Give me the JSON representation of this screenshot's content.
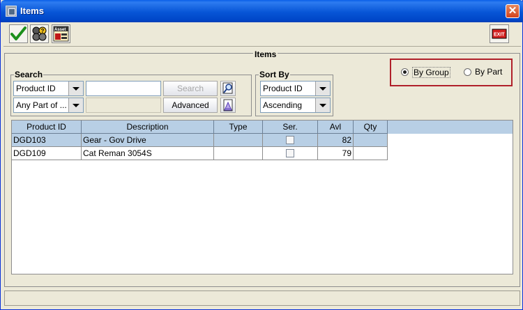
{
  "window": {
    "title": "Items",
    "close_glyph": "✕"
  },
  "toolbar": {
    "accept_icon": "checkmark-icon",
    "lookup_icon": "group-help-icon",
    "asset_icon": "asset-icon",
    "asset_text": "Asset",
    "exit_text": "EXIT"
  },
  "panel": {
    "title": "Items"
  },
  "search": {
    "group_title": "Search",
    "field_combo": "Product ID",
    "match_combo": "Any Part of ...",
    "query_value": "",
    "search_button": "Search",
    "advanced_button": "Advanced"
  },
  "sort": {
    "group_title": "Sort By",
    "field_combo": "Product ID",
    "order_combo": "Ascending"
  },
  "view_mode": {
    "by_group_label": "By Group",
    "by_part_label": "By Part",
    "selected": "By Group"
  },
  "table": {
    "columns": [
      "Product ID",
      "Description",
      "Type",
      "Ser.",
      "Avl",
      "Qty"
    ],
    "rows": [
      {
        "product_id": "DGD103",
        "description": "Gear - Gov Drive",
        "type": "",
        "serialized": false,
        "avl": "82",
        "qty": "",
        "selected": true
      },
      {
        "product_id": "DGD109",
        "description": "Cat Reman 3054S",
        "type": "",
        "serialized": false,
        "avl": "79",
        "qty": "",
        "selected": false
      }
    ]
  },
  "colors": {
    "title_bar": "#0755d6",
    "header_row": "#b8cfe5",
    "highlight_box": "#b0202a",
    "exit_red": "#d32020"
  }
}
